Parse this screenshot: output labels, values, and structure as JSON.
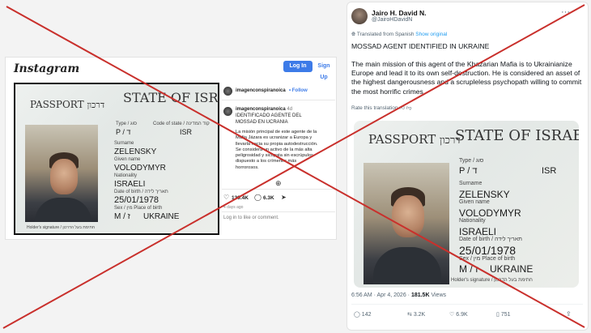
{
  "instagram": {
    "logo": "Instagram",
    "login_label": "Log In",
    "signup_label": "Sign Up",
    "username": "imagenconspiranoica",
    "follow_label": "• Follow",
    "caption_user": "imagenconspiranoica",
    "caption_age": "4d",
    "caption": "IDENTIFICADO AGENTE DEL MOSSAD EN UCRANIA",
    "caption_body": "La misión principal de este agente de la Mafia Jázara es ucranizar a Europa y llevarla hacia su propia autodestrucción. Se considera un activo de la más alta peligrosidad y sicópata sin escrúpulos dispuesto a los crímenes más horrorosos.",
    "likes": "139.4K",
    "comments": "6.3K",
    "time_ago": "4 days ago",
    "login_prompt": "Log in to like or comment."
  },
  "twitter": {
    "name": "Jairo H. David N.",
    "handle": "@JairoHDavidN",
    "translated_note": "Translated from Spanish",
    "show_original": "Show original",
    "headline": "MOSSAD AGENT IDENTIFIED IN UKRAINE",
    "body": "The main mission of this agent of the Khazarian Mafia is to Ukrainianize Europe and lead it to its own self-destruction. He is considered an asset of the highest dangerousness and a scrupleless psychopath willing to commit the most horrific crimes.",
    "rate_translation": "Rate this translation",
    "timestamp": "6:56 AM · Apr 4, 2026 · ",
    "views_count": "181.5K",
    "views_label": " Views",
    "replies": "142",
    "retweets": "3.2K",
    "likes": "6.9K",
    "bookmarks": "751"
  },
  "passport": {
    "passport_label": "PASSPORT",
    "passport_hebrew": "דרכון",
    "state": "STATE OF ISRAEL",
    "type_label": "Type / סוג",
    "type_value": "P / ד",
    "code_label": "Code of state / קוד המדינה",
    "code_value": "ISR",
    "surname_label": "Surname",
    "surname_value": "ZELENSKY",
    "given_label": "Given name",
    "given_value": "VOLODYMYR",
    "nationality_label": "Nationality",
    "nationality_value": "ISRAELI",
    "dob_label": "Date of birth / תאריך לידה",
    "dob_value": "25/01/1978",
    "sex_label": "Sex / מין   Place of birth",
    "sex_value": "M / ז",
    "pob_value": "UKRAINE",
    "holder_label": "Holder's signature / חתימת בעל הדרכון"
  },
  "colors": {
    "cross": "#c9302c",
    "accent": "#3d7be8"
  }
}
